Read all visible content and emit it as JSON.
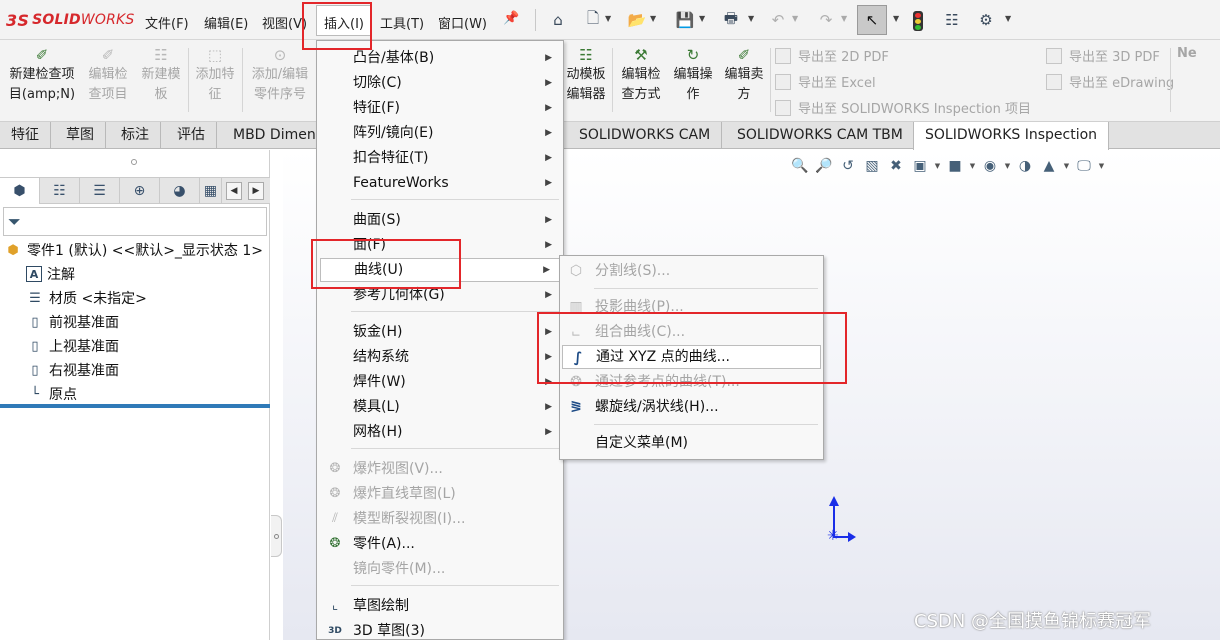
{
  "app": {
    "logo_prefix": "3S",
    "logo_main": "SOLID",
    "logo_suffix": "WORKS"
  },
  "menubar": {
    "items": [
      "文件(F)",
      "编辑(E)",
      "视图(V)",
      "插入(I)",
      "工具(T)",
      "窗口(W)"
    ]
  },
  "toolbar": {
    "icons": [
      "home-icon",
      "new-document-icon",
      "open-icon",
      "save-icon",
      "print-icon",
      "undo-icon",
      "redo-icon",
      "select-cursor-icon",
      "rebuild-traffic-light-icon",
      "file-properties-icon",
      "options-gear-icon"
    ]
  },
  "command_manager": {
    "buttons": [
      {
        "label_1": "新建检查项",
        "label_2": "目(amp;N)",
        "enabled": true
      },
      {
        "label_1": "编辑检",
        "label_2": "查项目",
        "enabled": false
      },
      {
        "label_1": "新建模",
        "label_2": "板",
        "enabled": false
      },
      {
        "label_1": "添加特",
        "label_2": "征",
        "enabled": false
      },
      {
        "label_1": "添加/编辑",
        "label_2": "零件序号",
        "enabled": false
      },
      {
        "label_1": "动模板",
        "label_2": "编辑器",
        "enabled": true
      },
      {
        "label_1": "编辑检",
        "label_2": "查方式",
        "enabled": true
      },
      {
        "label_1": "编辑操",
        "label_2": "作",
        "enabled": true
      },
      {
        "label_1": "编辑卖",
        "label_2": "方",
        "enabled": true
      }
    ],
    "exports": [
      {
        "label": "导出至 2D PDF"
      },
      {
        "label": "导出至 Excel"
      },
      {
        "label": "导出至 SOLIDWORKS Inspection 项目"
      },
      {
        "label": "导出至 3D PDF"
      },
      {
        "label": "导出至 eDrawing"
      },
      {
        "label": "Ne"
      }
    ]
  },
  "tabs": [
    "特征",
    "草图",
    "标注",
    "评估",
    "MBD Dimen",
    "SOLIDWORKS CAM",
    "SOLIDWORKS CAM TBM",
    "SOLIDWORKS Inspection"
  ],
  "feature_tree": {
    "root": "零件1 (默认) <<默认>_显示状态 1>",
    "items": [
      "注解",
      "材质 <未指定>",
      "前视基准面",
      "上视基准面",
      "右视基准面",
      "原点"
    ]
  },
  "insert_menu": {
    "items": [
      {
        "label": "凸台/基体(B)",
        "submenu": true,
        "enabled": true
      },
      {
        "label": "切除(C)",
        "submenu": true,
        "enabled": true
      },
      {
        "label": "特征(F)",
        "submenu": true,
        "enabled": true
      },
      {
        "label": "阵列/镜向(E)",
        "submenu": true,
        "enabled": true
      },
      {
        "label": "扣合特征(T)",
        "submenu": true,
        "enabled": true
      },
      {
        "label": "FeatureWorks",
        "submenu": true,
        "enabled": true
      },
      {
        "label": "曲面(S)",
        "submenu": true,
        "enabled": true
      },
      {
        "label": "面(F)",
        "submenu": true,
        "enabled": true
      },
      {
        "label": "曲线(U)",
        "submenu": true,
        "enabled": true,
        "highlighted": true
      },
      {
        "label": "参考几何体(G)",
        "submenu": true,
        "enabled": true
      },
      {
        "label": "钣金(H)",
        "submenu": true,
        "enabled": true
      },
      {
        "label": "结构系统",
        "submenu": true,
        "enabled": true
      },
      {
        "label": "焊件(W)",
        "submenu": true,
        "enabled": true
      },
      {
        "label": "模具(L)",
        "submenu": true,
        "enabled": true
      },
      {
        "label": "网格(H)",
        "submenu": true,
        "enabled": true
      },
      {
        "label": "爆炸视图(V)...",
        "submenu": false,
        "enabled": false
      },
      {
        "label": "爆炸直线草图(L)",
        "submenu": false,
        "enabled": false
      },
      {
        "label": "模型断裂视图(I)...",
        "submenu": false,
        "enabled": false
      },
      {
        "label": "零件(A)...",
        "submenu": false,
        "enabled": true
      },
      {
        "label": "镜向零件(M)...",
        "submenu": false,
        "enabled": false
      },
      {
        "label": "草图绘制",
        "submenu": false,
        "enabled": true
      },
      {
        "label": "3D 草图(3)",
        "submenu": false,
        "enabled": true
      }
    ]
  },
  "curve_submenu": {
    "items": [
      {
        "label": "分割线(S)...",
        "enabled": false
      },
      {
        "label": "投影曲线(P)...",
        "enabled": false
      },
      {
        "label": "组合曲线(C)...",
        "enabled": false
      },
      {
        "label": "通过 XYZ 点的曲线...",
        "enabled": true,
        "highlighted": true
      },
      {
        "label": "通过参考点的曲线(T)...",
        "enabled": false
      },
      {
        "label": "螺旋线/涡状线(H)...",
        "enabled": true
      },
      {
        "label": "自定义菜单(M)",
        "enabled": true
      }
    ]
  },
  "watermark": "CSDN @全国摸鱼锦标赛冠军",
  "colors": {
    "accent_red": "#e3262a",
    "logo_red": "#d6282c",
    "triad_blue": "#1a2ee8",
    "panel_blue_line": "#2f7ab8"
  }
}
